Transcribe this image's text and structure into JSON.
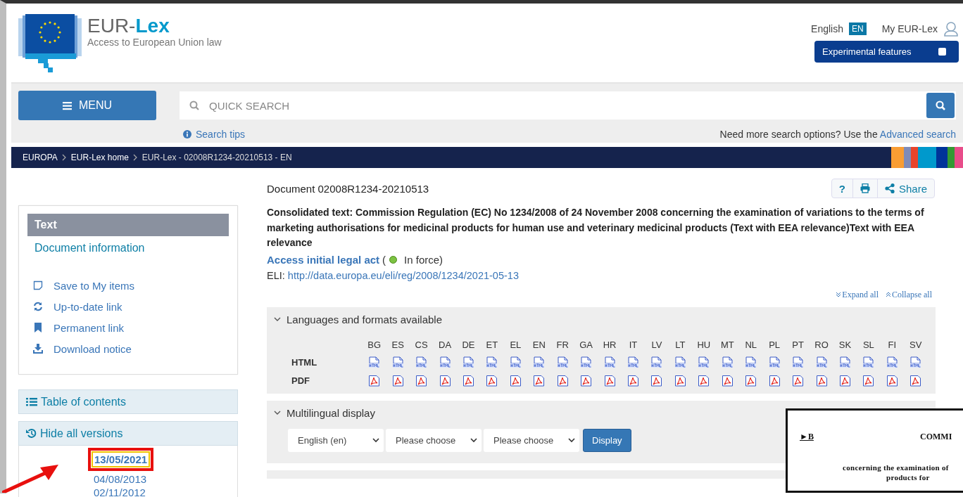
{
  "header": {
    "logo_plain": "EUR-",
    "logo_bold": "Lex",
    "tagline": "Access to European Union law",
    "language": "English",
    "language_code": "EN",
    "account": "My EUR-Lex",
    "experimental": {
      "label": "Experimental features",
      "checked": false
    }
  },
  "search": {
    "menu": "MENU",
    "placeholder": "QUICK SEARCH",
    "tips": "Search tips",
    "more_options": "Need more search options? Use the",
    "advanced": "Advanced search"
  },
  "breadcrumb": [
    "EUROPA",
    "EUR-Lex home",
    "EUR-Lex - 02008R1234-20210513 - EN"
  ],
  "sidebar": {
    "tab": {
      "label": "Text",
      "selected": true
    },
    "info": "Document information",
    "actions": [
      {
        "label": "Save to My items",
        "kind": "save"
      },
      {
        "label": "Up-to-date link",
        "kind": "refresh"
      },
      {
        "label": "Permanent link",
        "kind": "bookmark"
      },
      {
        "label": "Download notice",
        "kind": "download"
      }
    ],
    "toc": "Table of contents",
    "versions_toggle": "Hide all versions",
    "versions": [
      {
        "date": "13/05/2021",
        "selected": true
      },
      {
        "date": "04/08/2013",
        "selected": false
      },
      {
        "date": "02/11/2012",
        "selected": false
      }
    ]
  },
  "document": {
    "id": "Document 02008R1234-20210513",
    "tools": [
      {
        "kind": "help",
        "label": "?"
      },
      {
        "kind": "print"
      },
      {
        "kind": "share",
        "label": "Share"
      }
    ],
    "title": "Consolidated text: Commission Regulation (EC) No 1234/2008 of 24 November 2008 concerning the examination of variations to the terms of marketing authorisations for medicinal products for human use and veterinary medicinal products (Text with EEA relevance)Text with EEA relevance",
    "initial_act": "Access initial legal act",
    "status_open": "(",
    "status": "In force)",
    "eli_label": "ELI:",
    "eli_url": "http://data.europa.eu/eli/reg/2008/1234/2021-05-13",
    "expand": "Expand all",
    "collapse": "Collapse all",
    "languages": {
      "title": "Languages and formats available",
      "expanded": true,
      "codes": [
        "BG",
        "ES",
        "CS",
        "DA",
        "DE",
        "ET",
        "EL",
        "EN",
        "FR",
        "GA",
        "HR",
        "IT",
        "LV",
        "LT",
        "HU",
        "MT",
        "NL",
        "PL",
        "PT",
        "RO",
        "SK",
        "SL",
        "FI",
        "SV"
      ],
      "formats": [
        {
          "label": "HTML",
          "kind": "html"
        },
        {
          "label": "PDF",
          "kind": "pdf"
        }
      ]
    },
    "multilingual": {
      "title": "Multilingual display",
      "expanded": true,
      "selects": [
        "English (en)",
        "Please choose",
        "Please choose"
      ],
      "button": "Display"
    }
  },
  "preview": {
    "marker": "►B",
    "heading": "COMMI",
    "lines": [
      "concerning the examination of",
      "products for"
    ]
  }
}
